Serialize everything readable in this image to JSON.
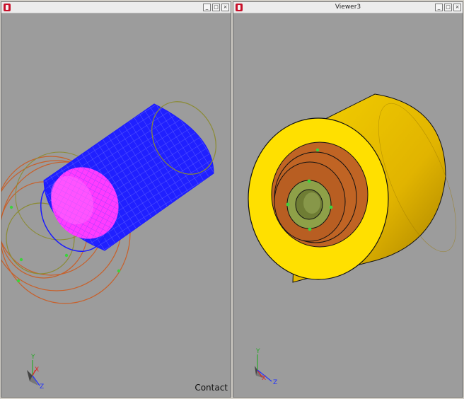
{
  "windows": {
    "left": {
      "title": "",
      "controls": {
        "minimize": "_",
        "maximize": "□",
        "close": "×"
      },
      "overlay_text": "Contact",
      "axes": {
        "x": "X",
        "y": "Y",
        "z": "Z"
      }
    },
    "right": {
      "title": "Viewer3",
      "controls": {
        "minimize": "_",
        "maximize": "□",
        "close": "×"
      },
      "axes": {
        "x": "X",
        "y": "Y",
        "z": "Z"
      }
    }
  },
  "colors": {
    "viewport_bg": "#9c9c9c",
    "mesh_blue": "#1a1aff",
    "mesh_magenta": "#ff2cff",
    "ring_orange": "#c8602a",
    "ring_olive": "#8b8b32",
    "handle_green": "#3cd23c",
    "cylinder_yellow": "#ffe000",
    "cylinder_shade": "#d9ae00",
    "inner_orange": "#c06424",
    "inner_green": "#8ea048"
  },
  "icons": {
    "app": "app-icon",
    "axis_triad": "axis-triad-icon"
  }
}
